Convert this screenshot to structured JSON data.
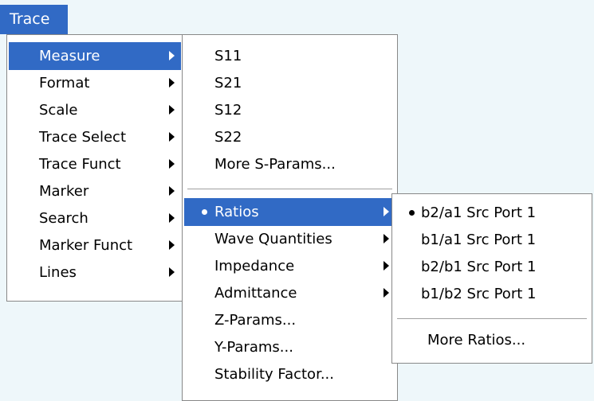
{
  "menubar": {
    "trace_label": "Trace"
  },
  "trace_menu": {
    "items": [
      {
        "label": "Measure"
      },
      {
        "label": "Format"
      },
      {
        "label": "Scale"
      },
      {
        "label": "Trace Select"
      },
      {
        "label": "Trace Funct"
      },
      {
        "label": "Marker"
      },
      {
        "label": "Search"
      },
      {
        "label": "Marker Funct"
      },
      {
        "label": "Lines"
      }
    ]
  },
  "measure_menu": {
    "items": [
      {
        "label": "S11"
      },
      {
        "label": "S21"
      },
      {
        "label": "S12"
      },
      {
        "label": "S22"
      },
      {
        "label": "More S-Params..."
      },
      {
        "label": "Ratios"
      },
      {
        "label": "Wave Quantities"
      },
      {
        "label": "Impedance"
      },
      {
        "label": "Admittance"
      },
      {
        "label": "Z-Params..."
      },
      {
        "label": "Y-Params..."
      },
      {
        "label": "Stability Factor..."
      }
    ]
  },
  "ratios_menu": {
    "items": [
      {
        "label": "b2/a1 Src Port 1"
      },
      {
        "label": "b1/a1 Src Port 1"
      },
      {
        "label": "b2/b1 Src Port 1"
      },
      {
        "label": "b1/b2 Src Port 1"
      },
      {
        "label": "More Ratios..."
      }
    ]
  },
  "colors": {
    "highlight": "#316ac5",
    "background": "#eef7fa"
  }
}
